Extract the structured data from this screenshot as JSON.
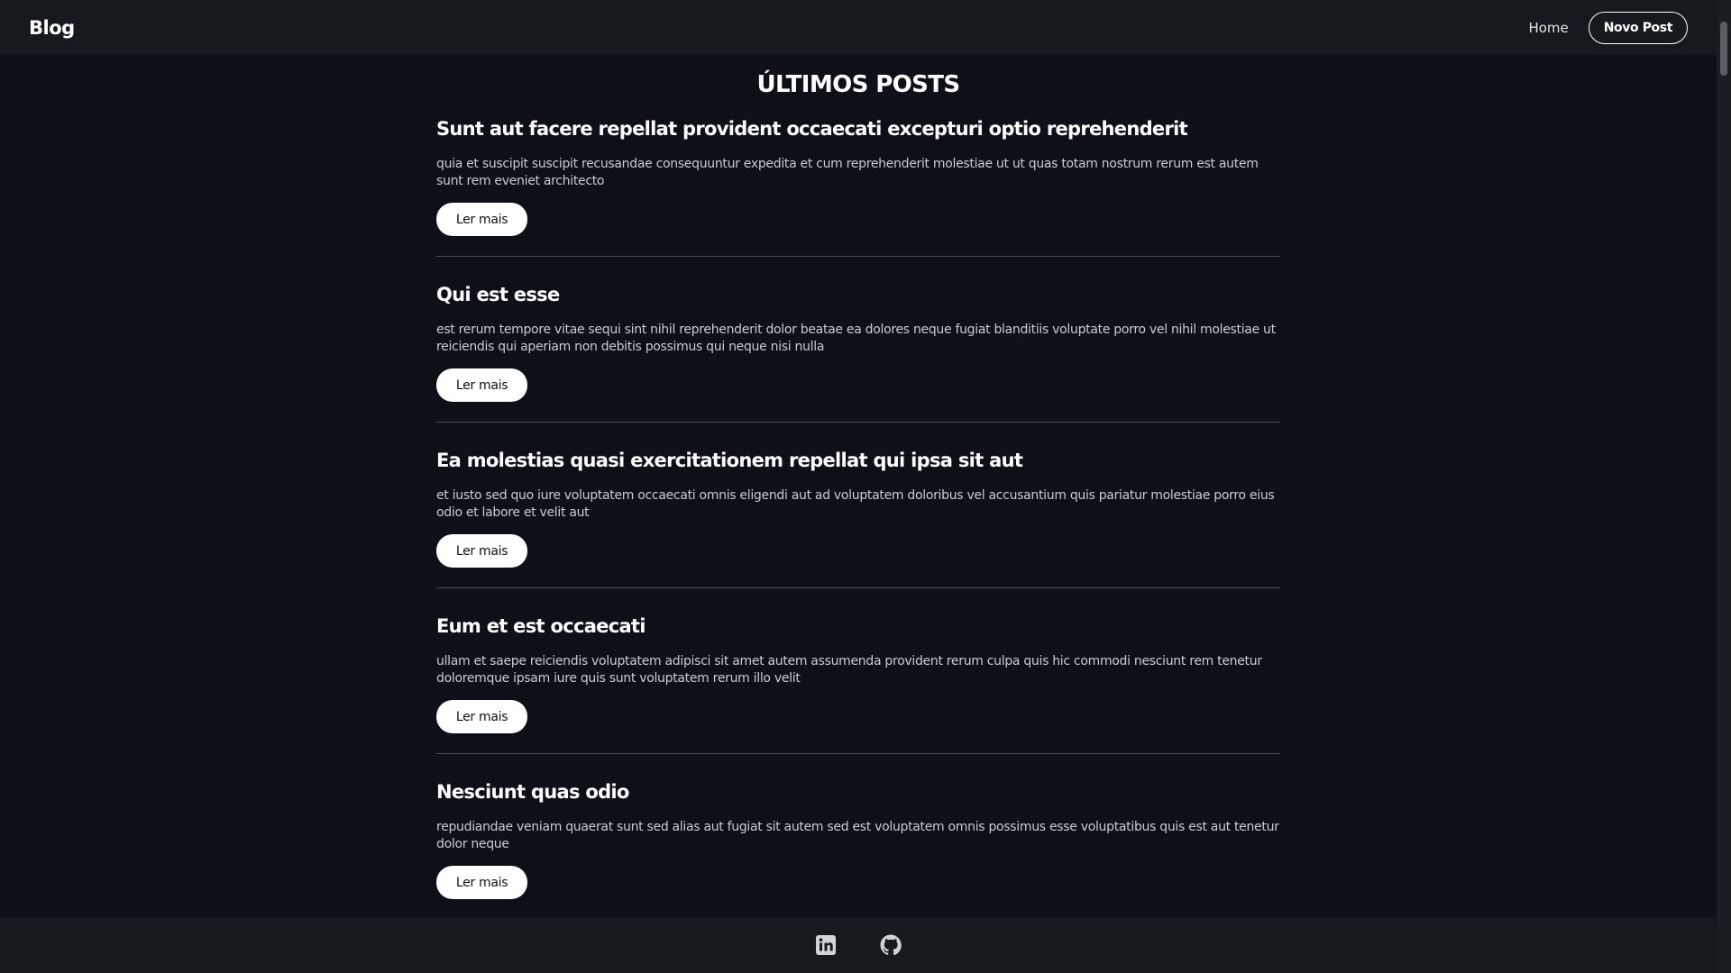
{
  "header": {
    "brand": "Blog",
    "nav_home": "Home",
    "new_post_label": "Novo Post"
  },
  "main": {
    "title": "ÚLTIMOS POSTS",
    "posts": [
      {
        "title": "Sunt aut facere repellat provident occaecati excepturi optio reprehenderit",
        "body": "quia et suscipit suscipit recusandae consequuntur expedita et cum reprehenderit molestiae ut ut quas totam nostrum rerum est autem sunt rem eveniet architecto",
        "button": "Ler mais"
      },
      {
        "title": "Qui est esse",
        "body": "est rerum tempore vitae sequi sint nihil reprehenderit dolor beatae ea dolores neque fugiat blanditiis voluptate porro vel nihil molestiae ut reiciendis qui aperiam non debitis possimus qui neque nisi nulla",
        "button": "Ler mais"
      },
      {
        "title": "Ea molestias quasi exercitationem repellat qui ipsa sit aut",
        "body": "et iusto sed quo iure voluptatem occaecati omnis eligendi aut ad voluptatem doloribus vel accusantium quis pariatur molestiae porro eius odio et labore et velit aut",
        "button": "Ler mais"
      },
      {
        "title": "Eum et est occaecati",
        "body": "ullam et saepe reiciendis voluptatem adipisci sit amet autem assumenda provident rerum culpa quis hic commodi nesciunt rem tenetur doloremque ipsam iure quis sunt voluptatem rerum illo velit",
        "button": "Ler mais"
      },
      {
        "title": "Nesciunt quas odio",
        "body": "repudiandae veniam quaerat sunt sed alias aut fugiat sit autem sed est voluptatem omnis possimus esse voluptatibus quis est aut tenetur dolor neque",
        "button": "Ler mais"
      }
    ]
  },
  "footer": {
    "icons": [
      "linkedin-icon",
      "github-icon"
    ]
  },
  "colors": {
    "background": "#0d1117",
    "header_bg": "#161a1f",
    "text": "#ffffff",
    "body_text": "#c9ccd1",
    "divider": "#4a4d52"
  }
}
